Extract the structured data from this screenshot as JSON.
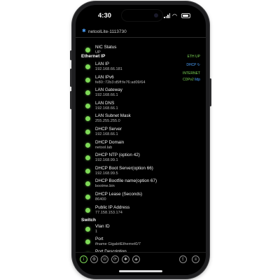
{
  "status_bar": {
    "time": "4:30"
  },
  "device": {
    "name": "netoolLite-1113730"
  },
  "status_tags": {
    "eth": "ETH UP",
    "dhcp": "DHCP",
    "dhcp_icon": "refresh-icon",
    "internet": "INTERNET",
    "cdp": "CDPv2",
    "cdp_extra": "lldp"
  },
  "nic": {
    "label": "NIC Status",
    "value": "UP"
  },
  "sections": {
    "ethernet": "Ethernet IP",
    "switch": "Switch"
  },
  "ethernet_rows": [
    {
      "label": "LAN IP",
      "value": "192.168.66.181"
    },
    {
      "label": "LAN IPv6",
      "value": "fe80::72b3:d5ff:fe76:ad09/64"
    },
    {
      "label": "LAN Gateway",
      "value": "192.168.66.1"
    },
    {
      "label": "LAN DNS",
      "value": "192.168.66.1"
    },
    {
      "label": "LAN Subnet Mask",
      "value": "255.255.255.0"
    },
    {
      "label": "DHCP Server",
      "value": "192.168.66.1"
    },
    {
      "label": "DHCP Domain",
      "value": "netool.lab"
    },
    {
      "label": "DHCP NTP (option 42)",
      "value": "192.168.99.1"
    },
    {
      "label": "DHCP Boot Server(option 66)",
      "value": "192.168.99.5"
    },
    {
      "label": "DHCP Bootfile name(option 67)",
      "value": "bootme.bin"
    },
    {
      "label": "DHCP Lease (Seconds)",
      "value": "86400"
    },
    {
      "label": "Public IP Address",
      "value": "77.158.153.174"
    }
  ],
  "switch_rows": [
    {
      "label": "Vlan ID",
      "value": "1"
    },
    {
      "label": "Port",
      "value": "ifname GigabitEthernet0/7"
    },
    {
      "label": "Port Description",
      "value": ""
    }
  ],
  "bottom_tabs": [
    {
      "icon": "info-icon",
      "glyph": "i"
    },
    {
      "icon": "settings-icon",
      "glyph": "⚙"
    },
    {
      "icon": "phone-icon",
      "glyph": "☏"
    },
    {
      "icon": "sync-icon",
      "glyph": "⟳"
    },
    {
      "icon": "star-icon",
      "glyph": "✱"
    },
    {
      "icon": "tag-icon",
      "glyph": "◈"
    },
    {
      "icon": "share-icon",
      "glyph": "⇪"
    },
    {
      "icon": "menu-icon",
      "glyph": "≡"
    }
  ],
  "colors": {
    "accent": "#7ed957",
    "bluetooth": "#4da3ff",
    "background": "#000000"
  }
}
